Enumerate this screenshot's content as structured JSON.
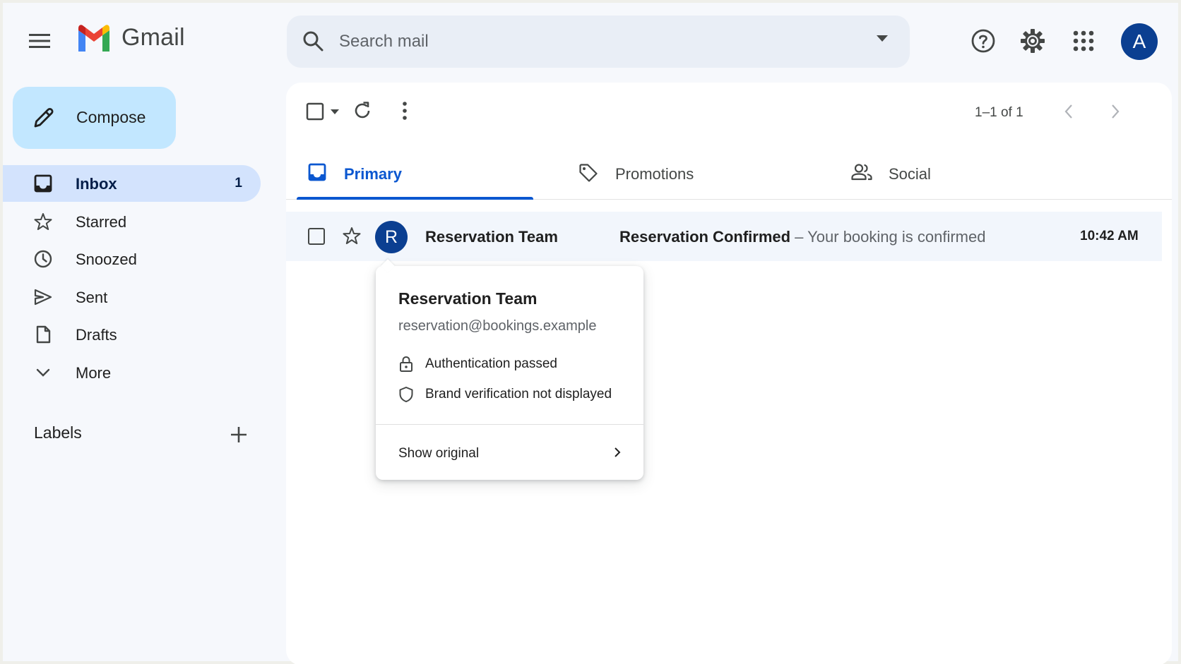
{
  "app": {
    "name": "Gmail",
    "brand_colors": {
      "blue": "#4285F4",
      "red": "#EA4335",
      "yellow": "#FBBC04",
      "green": "#34A853"
    },
    "accent": "#0b57d0"
  },
  "header": {
    "search_placeholder": "Search mail",
    "icons": [
      "menu-icon",
      "search-icon",
      "search-options-icon",
      "help-icon",
      "settings-icon",
      "apps-icon"
    ],
    "account_initial": "A"
  },
  "sidebar": {
    "compose_label": "Compose",
    "items": [
      {
        "label": "Inbox",
        "icon": "inbox-icon",
        "count": "1",
        "active": true
      },
      {
        "label": "Starred",
        "icon": "star-icon"
      },
      {
        "label": "Snoozed",
        "icon": "clock-icon"
      },
      {
        "label": "Sent",
        "icon": "send-icon"
      },
      {
        "label": "Drafts",
        "icon": "draft-icon"
      },
      {
        "label": "More",
        "icon": "chevron-down-icon"
      }
    ],
    "labels_header": "Labels"
  },
  "toolbar": {
    "pagination": "1–1 of 1"
  },
  "tabs": [
    {
      "label": "Primary",
      "icon": "inbox-tab-icon",
      "active": true
    },
    {
      "label": "Promotions",
      "icon": "tag-icon"
    },
    {
      "label": "Social",
      "icon": "people-icon"
    }
  ],
  "messages": [
    {
      "avatar_initial": "R",
      "sender": "Reservation Team",
      "subject": "Reservation Confirmed",
      "separator": " – ",
      "snippet": "Your booking is confirmed",
      "time": "10:42 AM"
    }
  ],
  "sender_card": {
    "name": "Reservation Team",
    "email": "reservation@bookings.example",
    "lines": [
      {
        "icon": "lock-icon",
        "text": "Authentication passed"
      },
      {
        "icon": "shield-icon",
        "text": "Brand verification not displayed"
      }
    ],
    "action_label": "Show original"
  }
}
